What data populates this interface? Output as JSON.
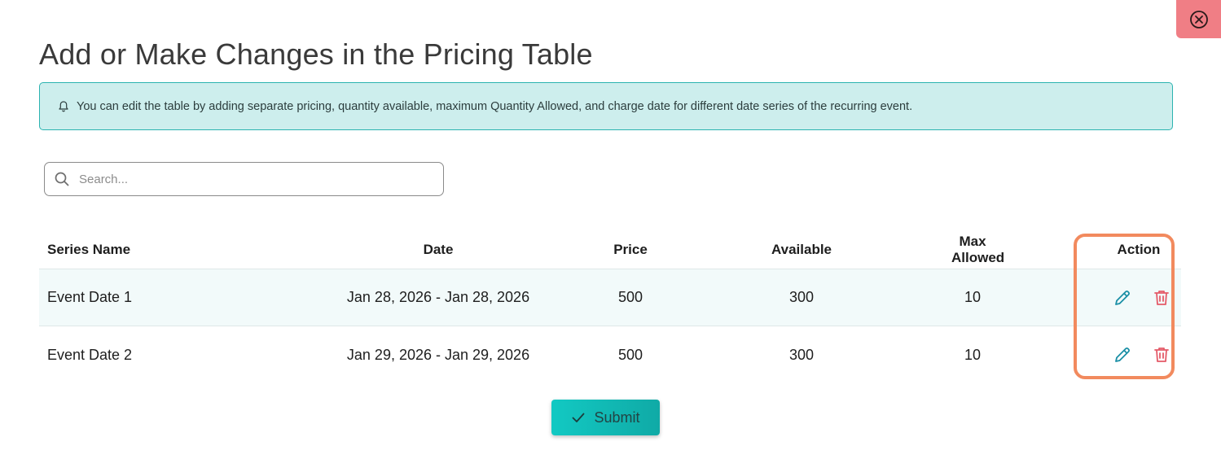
{
  "modal": {
    "title": "Add or Make Changes in the Pricing Table",
    "info_text": "You can edit the table by adding separate pricing, quantity available, maximum Quantity Allowed, and charge date for different date series of the recurring event.",
    "search_placeholder": "Search...",
    "submit_label": "Submit"
  },
  "table": {
    "headers": {
      "name": "Series Name",
      "date": "Date",
      "price": "Price",
      "available": "Available",
      "max": "Max Allowed",
      "action": "Action"
    },
    "rows": [
      {
        "name": "Event Date 1",
        "date": "Jan 28, 2026 - Jan 28, 2026",
        "price": "500",
        "available": "300",
        "max": "10"
      },
      {
        "name": "Event Date 2",
        "date": "Jan 29, 2026 - Jan 29, 2026",
        "price": "500",
        "available": "300",
        "max": "10"
      }
    ]
  },
  "colors": {
    "accent": "#12c9c3",
    "edit_icon": "#1a8fa6",
    "delete_icon": "#e45a68",
    "close_bg": "#f07e85",
    "highlight": "#f28a5e"
  },
  "icons": {
    "close": "close-icon",
    "bell": "bell-icon",
    "search": "search-icon",
    "edit": "pencil-icon",
    "delete": "trash-icon",
    "submit": "check-icon"
  }
}
